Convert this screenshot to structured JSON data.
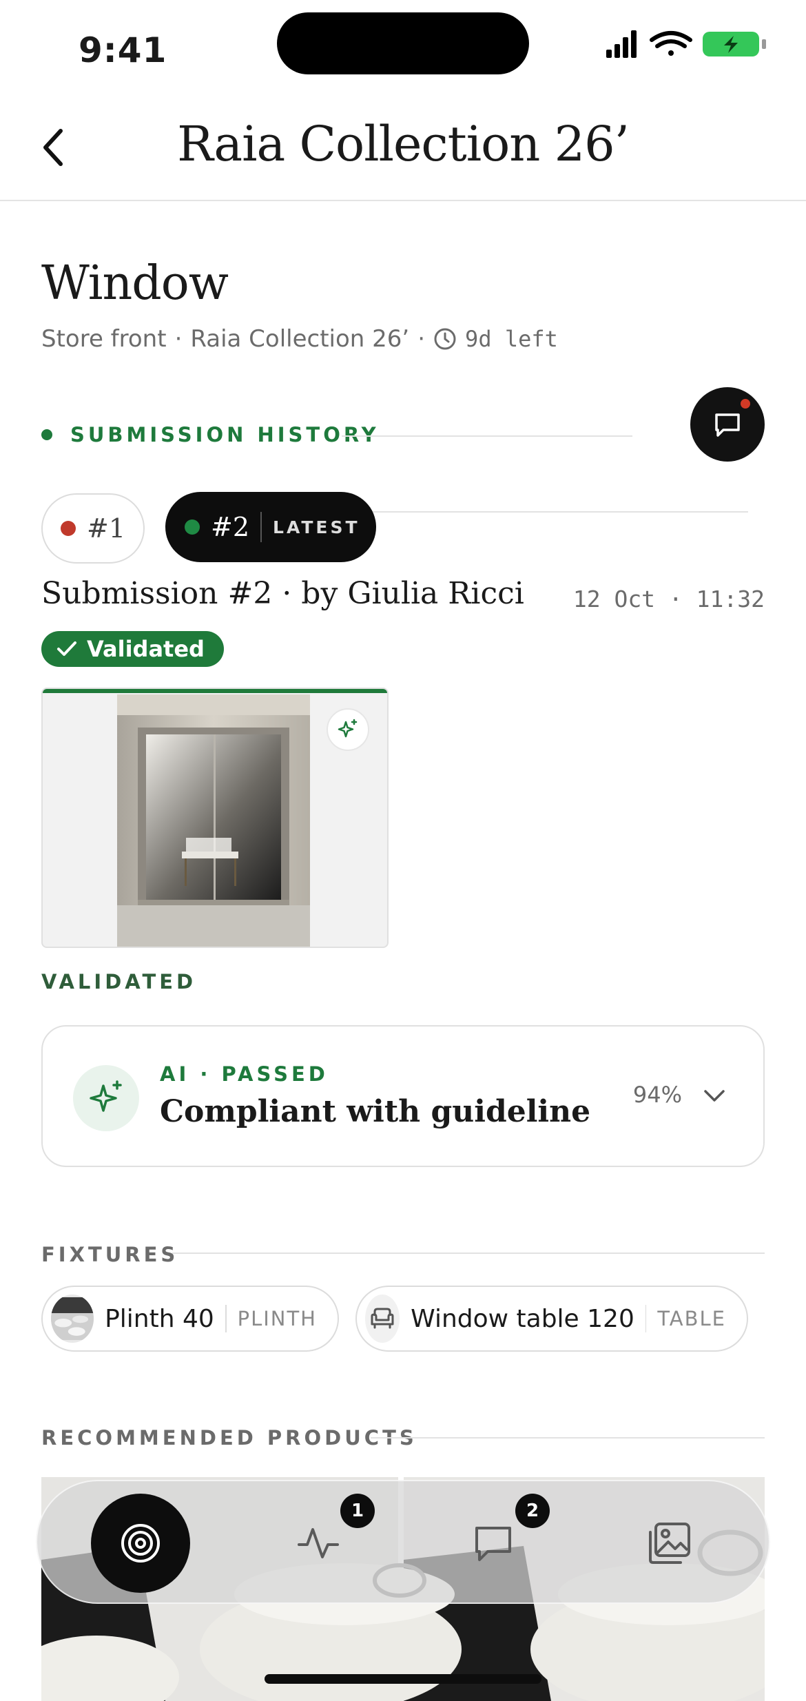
{
  "status_bar": {
    "time": "9:41"
  },
  "header": {
    "title": "Raia Collection 26’"
  },
  "page": {
    "heading": "Window",
    "meta_location": "Store front",
    "meta_collection": "Raia Collection 26’",
    "meta_deadline": "9d left"
  },
  "submission_history": {
    "label": "SUBMISSION HISTORY",
    "pills": [
      {
        "label": "#1",
        "status_color": "#c0392b"
      },
      {
        "label": "#2",
        "status_color": "#1f8a44",
        "tag": "LATEST"
      }
    ]
  },
  "submission": {
    "title": "Submission #2 · by Giulia Ricci",
    "date": "12 Oct · 11:32",
    "badge": "Validated"
  },
  "validated_caption": "VALIDATED",
  "ai_result": {
    "kicker": "AI · PASSED",
    "title": "Compliant with guideline",
    "confidence": "94%"
  },
  "fixtures": {
    "label": "FIXTURES",
    "items": [
      {
        "name": "Plinth 40",
        "type": "PLINTH"
      },
      {
        "name": "Window table 120",
        "type": "TABLE"
      }
    ]
  },
  "recommended": {
    "label": "RECOMMENDED PRODUCTS"
  },
  "nav": {
    "items": [
      {
        "icon": "target-icon",
        "active": true
      },
      {
        "icon": "activity-icon",
        "badge": "1"
      },
      {
        "icon": "chat-icon",
        "badge": "2"
      },
      {
        "icon": "gallery-icon"
      }
    ]
  },
  "colors": {
    "accent_green": "#1e7a3c",
    "alert_red": "#c0392b",
    "dark": "#0d0d0d"
  }
}
